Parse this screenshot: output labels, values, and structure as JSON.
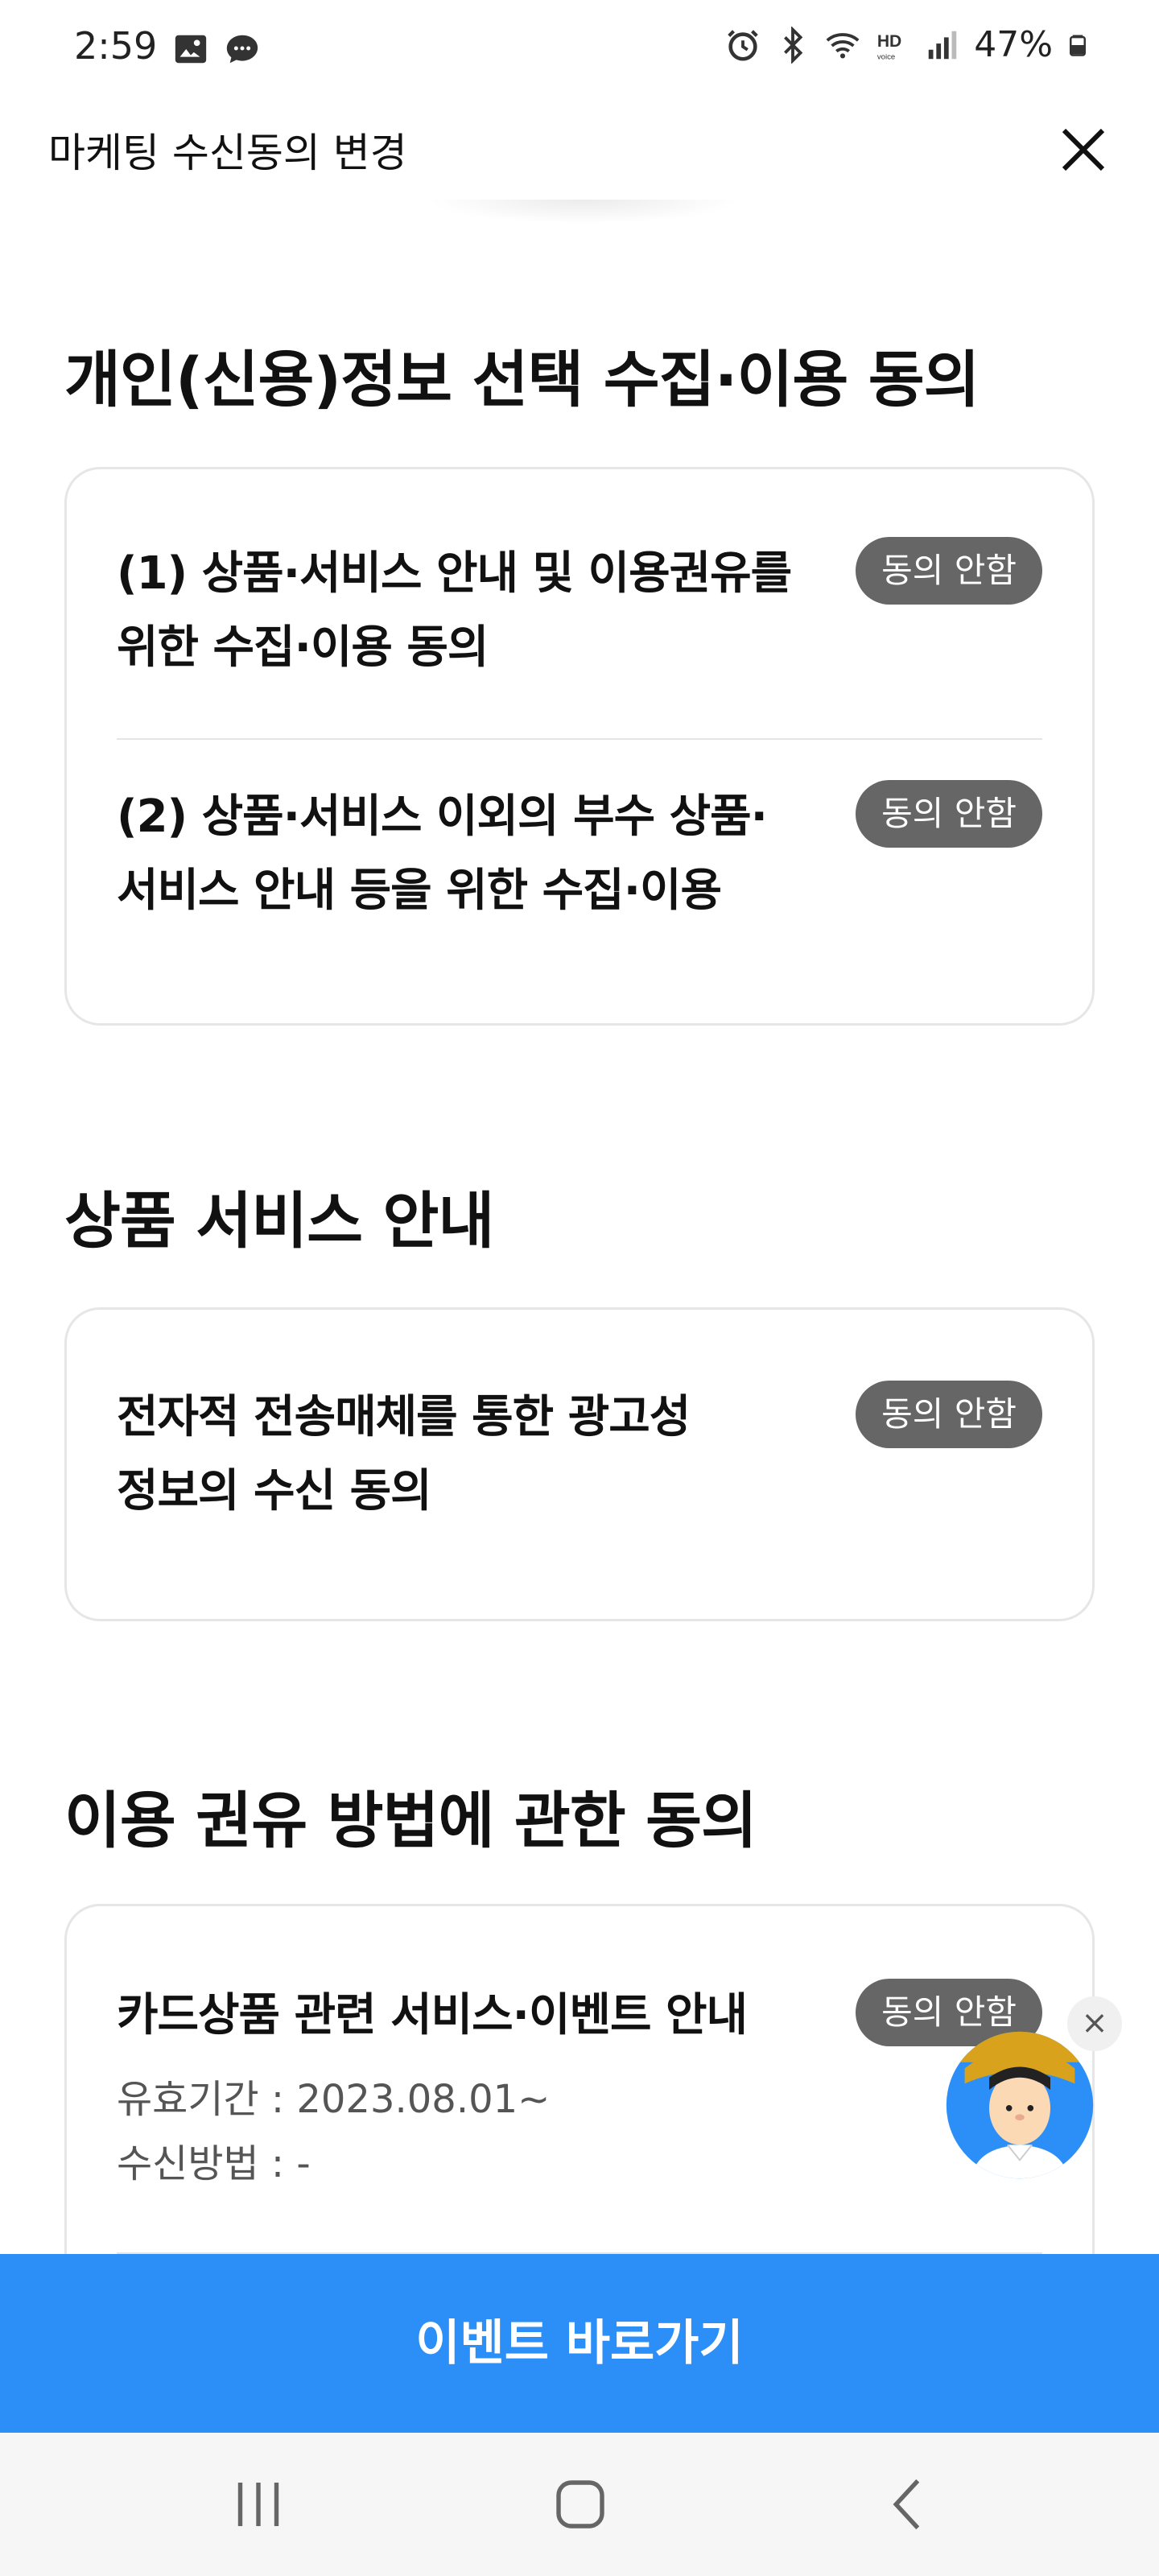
{
  "status_bar": {
    "time": "2:59",
    "battery": "47%",
    "left_icons": [
      "gallery-icon",
      "chat-bubble-icon"
    ],
    "right_icons": [
      "alarm-icon",
      "bluetooth-icon",
      "wifi-icon",
      "hd-voice-icon",
      "signal-icon",
      "battery-icon"
    ]
  },
  "header": {
    "title": "마케팅 수신동의 변경",
    "close_icon": "close-icon"
  },
  "sections": [
    {
      "title": "개인(신용)정보 선택 수집·이용 동의",
      "items": [
        {
          "line1": "(1) 상품·서비스 안내 및 이용권유를",
          "line2": "위한 수집·이용 동의",
          "badge": "동의 안함"
        },
        {
          "line1": "(2) 상품·서비스 이외의 부수 상품·",
          "line2": "서비스 안내 등을 위한 수집·이용",
          "badge": "동의 안함"
        }
      ]
    },
    {
      "title": "상품 서비스 안내",
      "items": [
        {
          "line1": "전자적 전송매체를 통한 광고성",
          "line2": "정보의 수신 동의",
          "badge": "동의 안함"
        }
      ]
    },
    {
      "title": "이용 권유 방법에 관한 동의",
      "items": [
        {
          "line1": "카드상품 관련 서비스·이벤트 안내",
          "period": "유효기간 : 2023.08.01~",
          "method": "수신방법 : -",
          "badge": "동의 안함"
        }
      ]
    }
  ],
  "chatbot": {
    "close_label": "×",
    "icon": "chatbot-avatar-icon"
  },
  "cta": {
    "label": "이벤트 바로가기"
  },
  "nav_bar": {
    "icons": [
      "recent-apps-icon",
      "home-icon",
      "back-icon"
    ]
  },
  "colors": {
    "accent": "#2b8ff7",
    "badge": "#666666",
    "card_border": "#e6e6e6"
  }
}
